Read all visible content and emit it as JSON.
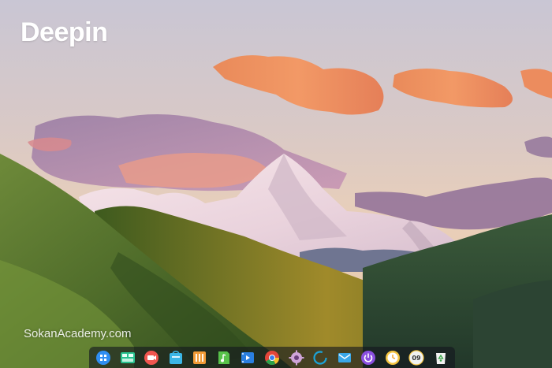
{
  "desktop": {
    "brand_title": "Deepin",
    "watermark": "SokanAcademy.com"
  },
  "dock": {
    "items": [
      {
        "name": "launcher",
        "icon": "launcher-icon",
        "color": "#2f8ef2"
      },
      {
        "name": "multitasking-view",
        "icon": "multitask-icon",
        "color": "#28c28f"
      },
      {
        "name": "screen-recorder",
        "icon": "record-icon",
        "color": "#f0564f"
      },
      {
        "name": "app-store",
        "icon": "store-icon",
        "color": "#3bb6e6"
      },
      {
        "name": "file-manager",
        "icon": "folder-icon",
        "color": "#f29b36"
      },
      {
        "name": "music-player",
        "icon": "music-icon",
        "color": "#58c24a"
      },
      {
        "name": "movie-player",
        "icon": "movie-icon",
        "color": "#2a7fe0"
      },
      {
        "name": "chrome-browser",
        "icon": "chrome-icon",
        "color": "#e3463a"
      },
      {
        "name": "control-center",
        "icon": "gear-icon",
        "color": "#cfa4d8"
      },
      {
        "name": "deepin-system-monitor",
        "icon": "ring-icon",
        "color": "#1ba3d8"
      },
      {
        "name": "mail",
        "icon": "mail-icon",
        "color": "#3aa7e8"
      },
      {
        "name": "power",
        "icon": "power-icon",
        "color": "#8a4fe0"
      },
      {
        "name": "clock",
        "icon": "clock-icon",
        "color": "#f5c542"
      },
      {
        "name": "calendar",
        "icon": "calendar-icon",
        "color": "#f2f2f2"
      },
      {
        "name": "trash",
        "icon": "trash-icon",
        "color": "#f2f2f2"
      }
    ],
    "calendar_label": "09"
  }
}
